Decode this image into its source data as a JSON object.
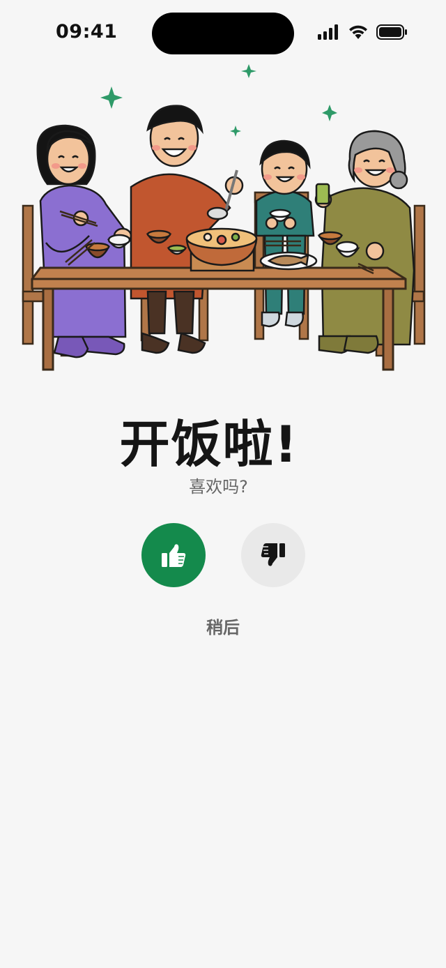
{
  "status_bar": {
    "time": "09:41",
    "icons": [
      "cellular-signal-icon",
      "wifi-icon",
      "battery-icon"
    ]
  },
  "illustration": {
    "subject": "family-dinner-illustration"
  },
  "main": {
    "title": "开饭啦!",
    "subtitle": "喜欢吗?",
    "like_icon": "thumbs-up-icon",
    "dislike_icon": "thumbs-down-icon",
    "later_label": "稍后"
  },
  "colors": {
    "background": "#f6f6f6",
    "accent_green": "#148a4c",
    "dislike_bg": "#e9e9e9",
    "sparkle": "#2e9a68",
    "table_wood": "#c1814e"
  }
}
